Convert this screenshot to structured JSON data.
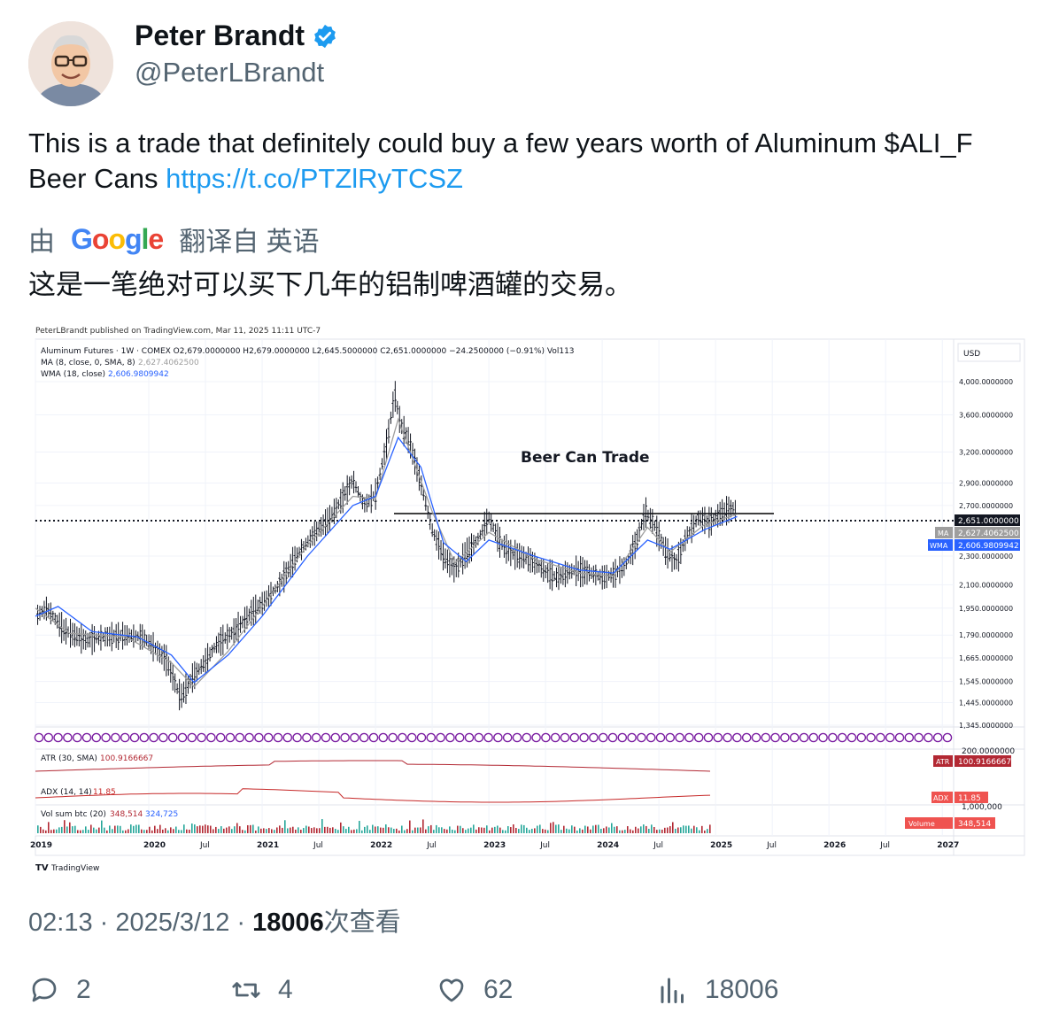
{
  "author": {
    "name": "Peter Brandt",
    "handle": "@PeterLBrandt",
    "verified_icon": "verified-badge-icon",
    "badge_color": "#1d9bf0"
  },
  "tweet": {
    "text_main": "This is a trade that definitely could buy a few years worth of Aluminum $ALI_F Beer Cans ",
    "link": "https://t.co/PTZlRyTCSZ",
    "translate_by": "由",
    "translate_brand": "Google",
    "translate_from": "翻译自 英语",
    "translated_text": "这是一笔绝对可以买下几年的铝制啤酒罐的交易。"
  },
  "chart": {
    "published": "PeterLBrandt published on TradingView.com, Mar 11, 2025 11:11 UTC-7",
    "ohlc_line": "Aluminum Futures · 1W · COMEX  O2,679.0000000  H2,679.0000000  L2,645.5000000  C2,651.0000000  −24.2500000 (−0.91%)  Vol113",
    "ma_label": "MA (8, close, 0, SMA, 8)",
    "ma_value": "2,627.4062500",
    "wma_label": "WMA (18, close)",
    "wma_value": "2,606.9809942",
    "currency": "USD",
    "annotation": "Beer Can Trade",
    "atr_label": "ATR (30, SMA)",
    "atr_value": "100.9166667",
    "atr_tag": "ATR",
    "adx_label": "ADX (14, 14)",
    "adx_value": "11.85",
    "adx_tag": "ADX",
    "vol_label": "Vol sum btc (20)",
    "vol_value1": "348,514",
    "vol_value2": "324,725",
    "vol_tag": "Volume",
    "price_tag": "2,651.0000000",
    "ma_tag": "MA",
    "wma_tag": "WMA",
    "tv_logo": "TradingView",
    "atr_scale_top": "200.0000000",
    "vol_scale": "1,000,000",
    "colors": {
      "ma": "#9e9e9e",
      "wma": "#2962ff",
      "atr": "#b22833",
      "adx": "#c62828",
      "vol_up": "#26a69a",
      "vol_down": "#b22833",
      "events": "#7b1fa2"
    }
  },
  "chart_data": {
    "type": "line",
    "title": "Aluminum Futures · 1W · COMEX",
    "annotation": "Beer Can Trade",
    "y_scale": "log",
    "ylim": [
      1345,
      4000
    ],
    "y_ticks": [
      "4,000.0000000",
      "3,600.0000000",
      "3,200.0000000",
      "2,900.0000000",
      "2,700.0000000",
      "2,300.0000000",
      "2,100.0000000",
      "1,950.0000000",
      "1,790.0000000",
      "1,665.0000000",
      "1,545.0000000",
      "1,445.0000000",
      "1,345.0000000"
    ],
    "x_ticks": [
      "2019",
      "2020",
      "Jul",
      "2021",
      "Jul",
      "2022",
      "Jul",
      "2023",
      "Jul",
      "2024",
      "Jul",
      "2025",
      "Jul",
      "2026",
      "Jul",
      "2027"
    ],
    "series": [
      {
        "name": "Aluminum Futures",
        "points": [
          [
            2019.0,
            1900
          ],
          [
            2019.1,
            1950
          ],
          [
            2019.25,
            1820
          ],
          [
            2019.45,
            1760
          ],
          [
            2019.6,
            1780
          ],
          [
            2019.8,
            1790
          ],
          [
            2019.95,
            1780
          ],
          [
            2020.05,
            1720
          ],
          [
            2020.15,
            1660
          ],
          [
            2020.28,
            1470
          ],
          [
            2020.38,
            1560
          ],
          [
            2020.5,
            1650
          ],
          [
            2020.6,
            1740
          ],
          [
            2020.75,
            1810
          ],
          [
            2020.9,
            1920
          ],
          [
            2021.0,
            1980
          ],
          [
            2021.15,
            2100
          ],
          [
            2021.3,
            2300
          ],
          [
            2021.45,
            2460
          ],
          [
            2021.6,
            2600
          ],
          [
            2021.7,
            2750
          ],
          [
            2021.8,
            2930
          ],
          [
            2021.9,
            2700
          ],
          [
            2022.0,
            2800
          ],
          [
            2022.1,
            3300
          ],
          [
            2022.17,
            3850
          ],
          [
            2022.22,
            3500
          ],
          [
            2022.3,
            3300
          ],
          [
            2022.4,
            2900
          ],
          [
            2022.5,
            2500
          ],
          [
            2022.6,
            2300
          ],
          [
            2022.7,
            2200
          ],
          [
            2022.8,
            2320
          ],
          [
            2022.9,
            2420
          ],
          [
            2023.0,
            2600
          ],
          [
            2023.1,
            2400
          ],
          [
            2023.2,
            2320
          ],
          [
            2023.35,
            2280
          ],
          [
            2023.5,
            2190
          ],
          [
            2023.6,
            2150
          ],
          [
            2023.75,
            2200
          ],
          [
            2023.9,
            2180
          ],
          [
            2024.0,
            2150
          ],
          [
            2024.1,
            2170
          ],
          [
            2024.2,
            2230
          ],
          [
            2024.3,
            2400
          ],
          [
            2024.38,
            2650
          ],
          [
            2024.45,
            2560
          ],
          [
            2024.55,
            2350
          ],
          [
            2024.65,
            2250
          ],
          [
            2024.75,
            2460
          ],
          [
            2024.85,
            2600
          ],
          [
            2024.95,
            2560
          ],
          [
            2025.05,
            2640
          ],
          [
            2025.15,
            2680
          ],
          [
            2025.19,
            2651
          ]
        ]
      },
      {
        "name": "MA",
        "points": [
          [
            2019.0,
            1950
          ],
          [
            2019.3,
            1800
          ],
          [
            2019.8,
            1780
          ],
          [
            2020.2,
            1640
          ],
          [
            2020.4,
            1520
          ],
          [
            2020.7,
            1700
          ],
          [
            2021.0,
            1960
          ],
          [
            2021.4,
            2380
          ],
          [
            2021.8,
            2780
          ],
          [
            2022.0,
            2760
          ],
          [
            2022.2,
            3550
          ],
          [
            2022.5,
            2650
          ],
          [
            2022.7,
            2250
          ],
          [
            2023.0,
            2480
          ],
          [
            2023.4,
            2280
          ],
          [
            2023.8,
            2180
          ],
          [
            2024.1,
            2160
          ],
          [
            2024.4,
            2520
          ],
          [
            2024.6,
            2330
          ],
          [
            2024.9,
            2540
          ],
          [
            2025.19,
            2627
          ]
        ]
      },
      {
        "name": "WMA",
        "points": [
          [
            2019.0,
            1900
          ],
          [
            2019.2,
            1960
          ],
          [
            2019.5,
            1810
          ],
          [
            2019.9,
            1780
          ],
          [
            2020.2,
            1680
          ],
          [
            2020.4,
            1540
          ],
          [
            2020.7,
            1680
          ],
          [
            2021.0,
            1900
          ],
          [
            2021.4,
            2300
          ],
          [
            2021.8,
            2700
          ],
          [
            2022.0,
            2780
          ],
          [
            2022.2,
            3350
          ],
          [
            2022.4,
            3050
          ],
          [
            2022.6,
            2400
          ],
          [
            2022.8,
            2260
          ],
          [
            2023.0,
            2420
          ],
          [
            2023.4,
            2300
          ],
          [
            2023.8,
            2200
          ],
          [
            2024.1,
            2180
          ],
          [
            2024.4,
            2420
          ],
          [
            2024.6,
            2350
          ],
          [
            2024.9,
            2500
          ],
          [
            2025.19,
            2607
          ]
        ]
      }
    ],
    "horizontal_lines": [
      2651,
      2700
    ],
    "grid": true,
    "legend": "top-left"
  },
  "footer": {
    "time": "02:13 · 2025/3/12 · ",
    "views": "18006",
    "views_label": "次查看"
  },
  "actions": {
    "reply_count": "2",
    "retweet_count": "4",
    "like_count": "62",
    "views_count": "18006"
  }
}
